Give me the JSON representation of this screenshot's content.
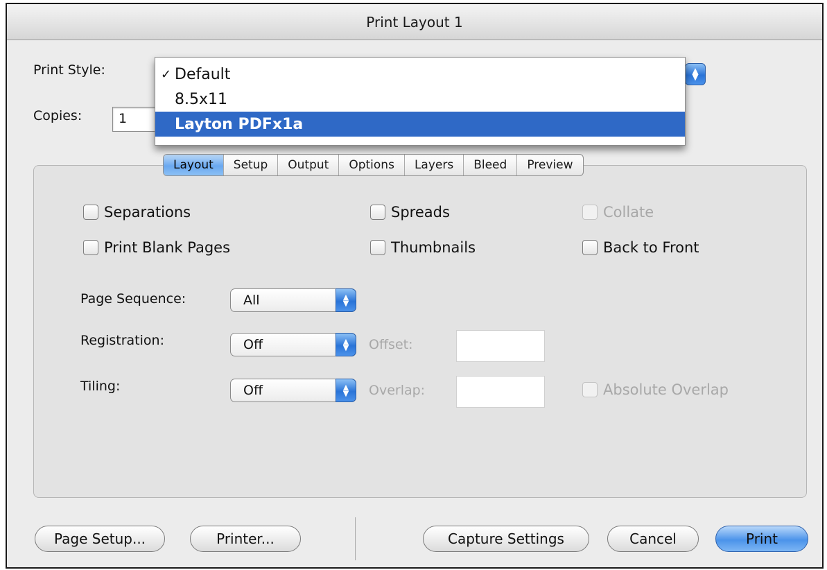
{
  "window": {
    "title": "Print Layout 1"
  },
  "print_style": {
    "label": "Print Style:",
    "menu_items": [
      {
        "label": "Default",
        "checked": true,
        "selected": false
      },
      {
        "label": "8.5x11",
        "checked": false,
        "selected": false
      },
      {
        "label": "Layton PDFx1a",
        "checked": false,
        "selected": true
      }
    ]
  },
  "copies": {
    "label": "Copies:",
    "value": "1"
  },
  "tabs": [
    {
      "label": "Layout",
      "active": true
    },
    {
      "label": "Setup",
      "active": false
    },
    {
      "label": "Output",
      "active": false
    },
    {
      "label": "Options",
      "active": false
    },
    {
      "label": "Layers",
      "active": false
    },
    {
      "label": "Bleed",
      "active": false
    },
    {
      "label": "Preview",
      "active": false
    }
  ],
  "checkboxes": {
    "separations": {
      "label": "Separations",
      "checked": false,
      "enabled": true
    },
    "spreads": {
      "label": "Spreads",
      "checked": false,
      "enabled": true
    },
    "collate": {
      "label": "Collate",
      "checked": false,
      "enabled": false
    },
    "print_blank_pages": {
      "label": "Print Blank Pages",
      "checked": false,
      "enabled": true
    },
    "thumbnails": {
      "label": "Thumbnails",
      "checked": false,
      "enabled": true
    },
    "back_to_front": {
      "label": "Back to Front",
      "checked": false,
      "enabled": true
    },
    "absolute_overlap": {
      "label": "Absolute Overlap",
      "checked": false,
      "enabled": false
    }
  },
  "page_sequence": {
    "label": "Page Sequence:",
    "value": "All"
  },
  "registration": {
    "label": "Registration:",
    "value": "Off",
    "offset_label": "Offset:"
  },
  "tiling": {
    "label": "Tiling:",
    "value": "Off",
    "overlap_label": "Overlap:"
  },
  "buttons": {
    "page_setup": "Page Setup...",
    "printer": "Printer...",
    "capture_settings": "Capture Settings",
    "cancel": "Cancel",
    "print": "Print"
  },
  "icons": {
    "checkmark": "✓",
    "popup_arrows": "up-down-arrows-icon"
  },
  "colors": {
    "accent": "#2f69c6",
    "button_blue": "#4b93ea"
  }
}
